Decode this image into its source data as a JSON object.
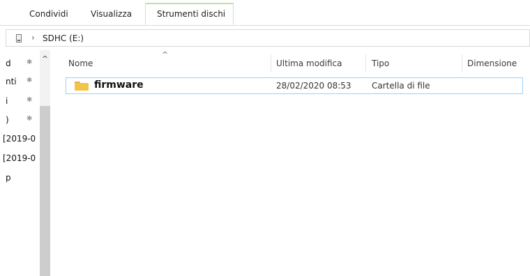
{
  "ribbon": {
    "tabs": [
      "Condividi",
      "Visualizza"
    ],
    "active_tab": "Strumenti dischi",
    "accent_color": "#bfe2a0"
  },
  "address": {
    "icon": "drive-icon",
    "separator": "›",
    "path": "SDHC (E:)"
  },
  "nav": {
    "items": [
      {
        "label": "d",
        "pinned": true
      },
      {
        "label": "nti",
        "pinned": true
      },
      {
        "label": "i",
        "pinned": true
      },
      {
        "label": ")",
        "pinned": true
      },
      {
        "label": "[2019-0",
        "pinned": false
      },
      {
        "label": "[2019-0",
        "pinned": false
      },
      {
        "label": "p",
        "pinned": false
      }
    ],
    "pin_glyph": "✱",
    "scroll_up_glyph": "^"
  },
  "files": {
    "sort_glyph": "^",
    "columns": [
      "Nome",
      "Ultima modifica",
      "Tipo",
      "Dimensione"
    ],
    "rows": [
      {
        "name": "firmware",
        "modified": "28/02/2020 08:53",
        "type": "Cartella di file",
        "size": "",
        "icon": "folder-icon"
      }
    ]
  }
}
